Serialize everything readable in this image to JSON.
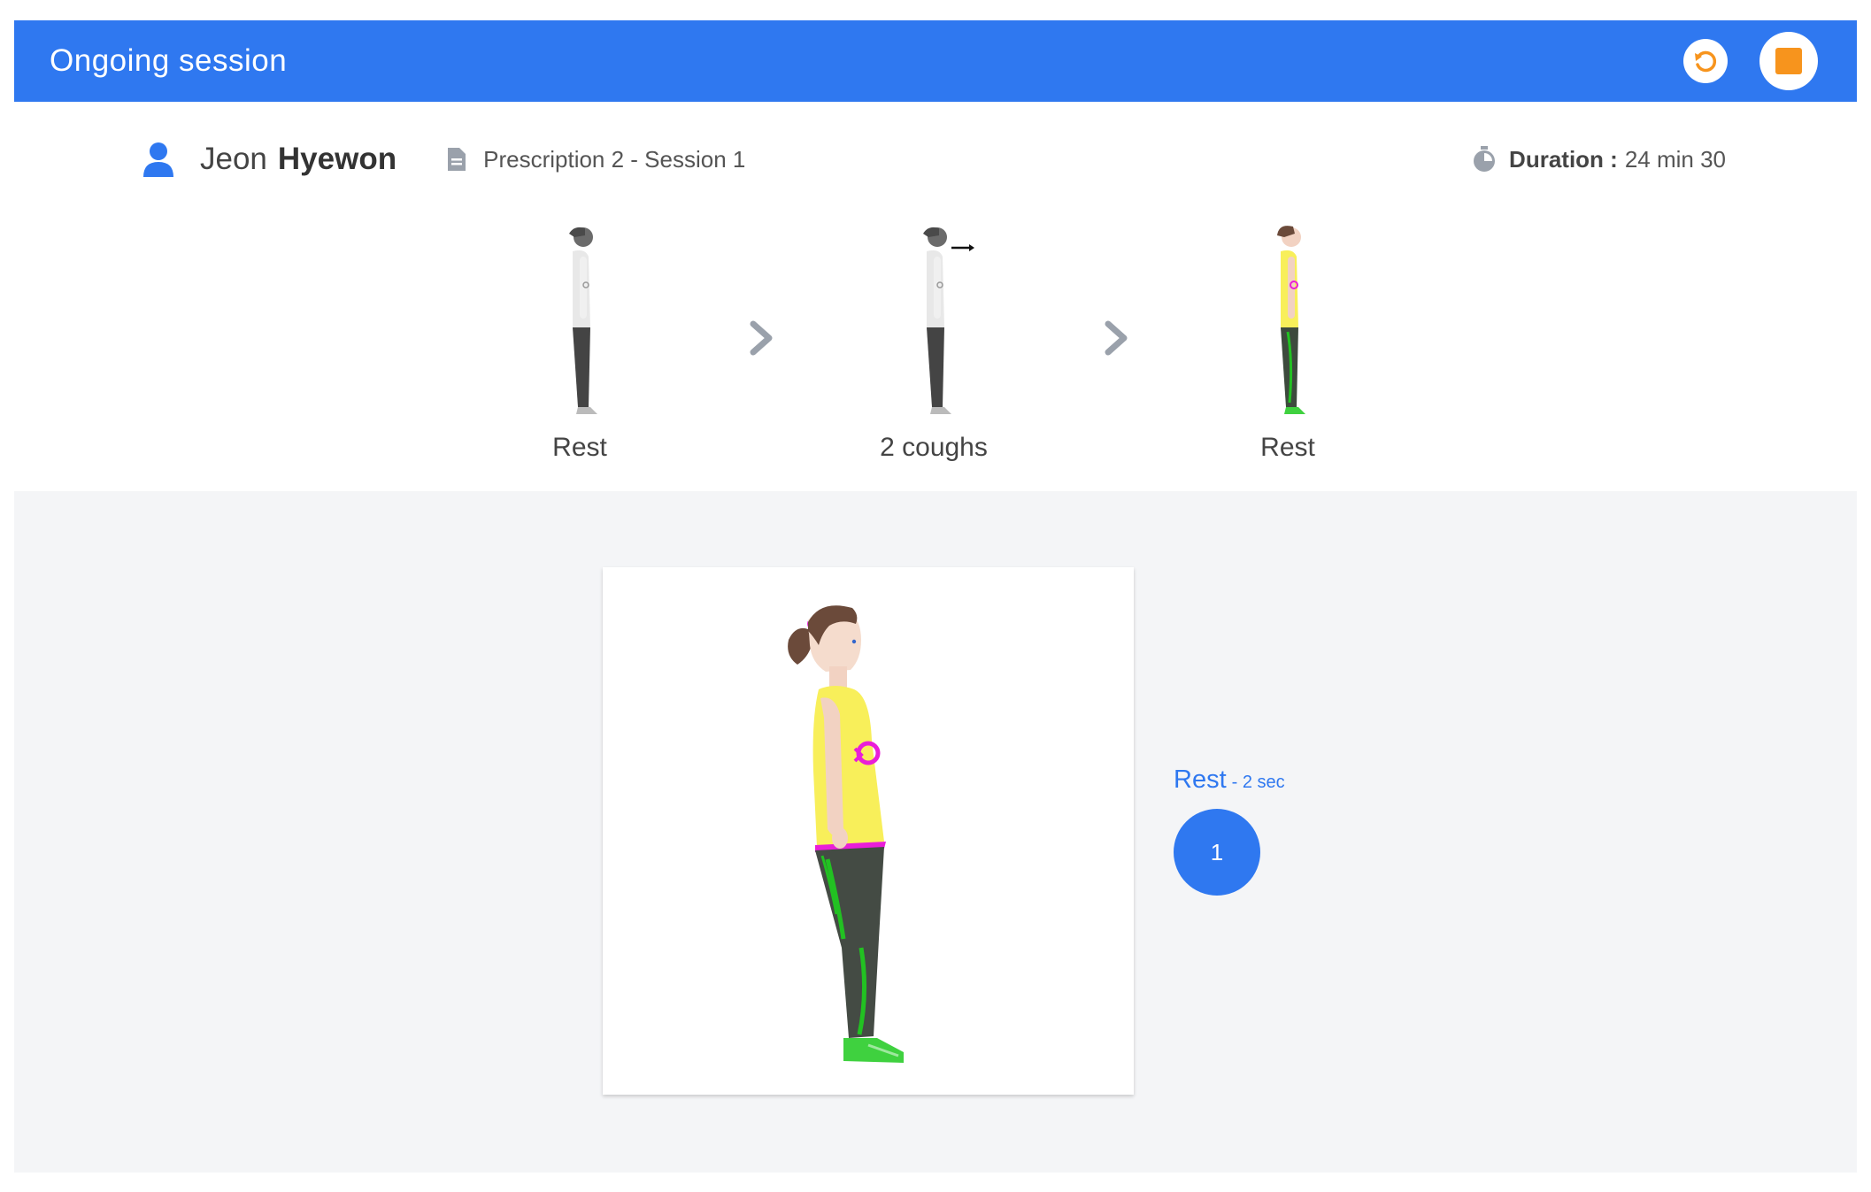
{
  "header": {
    "title": "Ongoing session",
    "restart_icon": "restart-icon",
    "stop_icon": "stop-icon",
    "accent": "#2f78f0",
    "stop_color": "#f7941d"
  },
  "patient": {
    "first_name": "Jeon",
    "last_name": "Hyewon",
    "icon": "user-icon"
  },
  "prescription": {
    "text": "Prescription 2 - Session 1",
    "icon": "document-icon"
  },
  "duration": {
    "label": "Duration :",
    "value": "24 min 30",
    "icon": "timer-icon"
  },
  "steps": [
    {
      "label": "Rest",
      "state": "done"
    },
    {
      "label": "2 coughs",
      "state": "done"
    },
    {
      "label": "Rest",
      "state": "current"
    }
  ],
  "current": {
    "exercise": "Rest",
    "duration": "- 2 sec",
    "count": "1"
  }
}
